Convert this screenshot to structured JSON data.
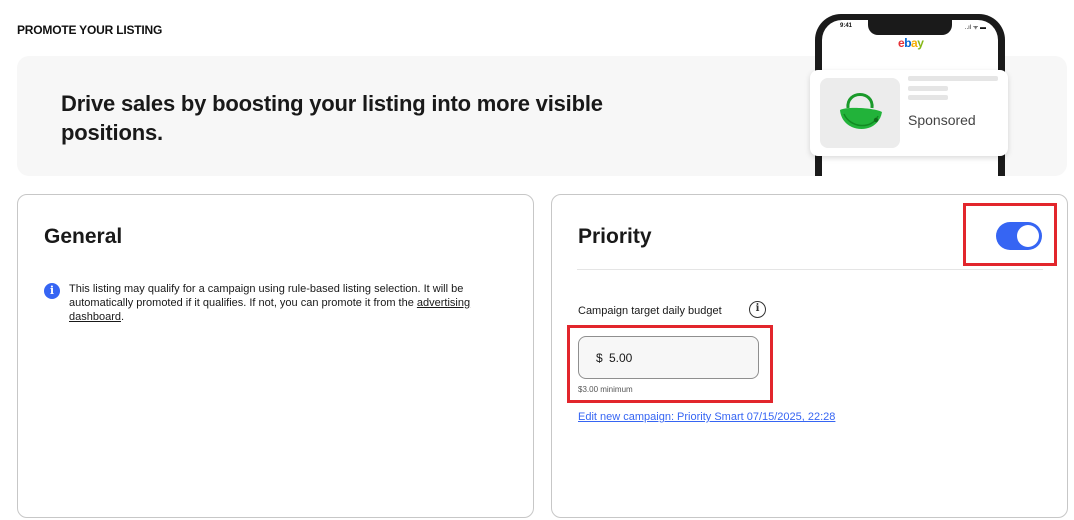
{
  "section_title": "PROMOTE YOUR LISTING",
  "banner": {
    "text": "Drive sales by boosting your listing into more visible positions.",
    "phone": {
      "time": "9:41",
      "status": "..ıl ᯤ ▬",
      "brand": [
        "e",
        "b",
        "a",
        "y"
      ],
      "sponsored_label": "Sponsored",
      "product_icon": "green-handbag-icon"
    }
  },
  "general": {
    "title": "General",
    "info_text": "This listing may qualify for a campaign using rule-based listing selection. It will be automatically promoted if it qualifies. If not, you can promote it from the",
    "info_link": "advertising dashboard",
    "info_suffix": "."
  },
  "priority": {
    "title": "Priority",
    "toggle_on": true,
    "accent_color": "#3665f3",
    "budget_label": "Campaign target daily budget",
    "budget_currency": "$",
    "budget_value": "5.00",
    "budget_minimum": "$3.00 minimum",
    "edit_link": "Edit new campaign: Priority Smart 07/15/2025, 22:28"
  },
  "highlight_color": "#e2262c"
}
